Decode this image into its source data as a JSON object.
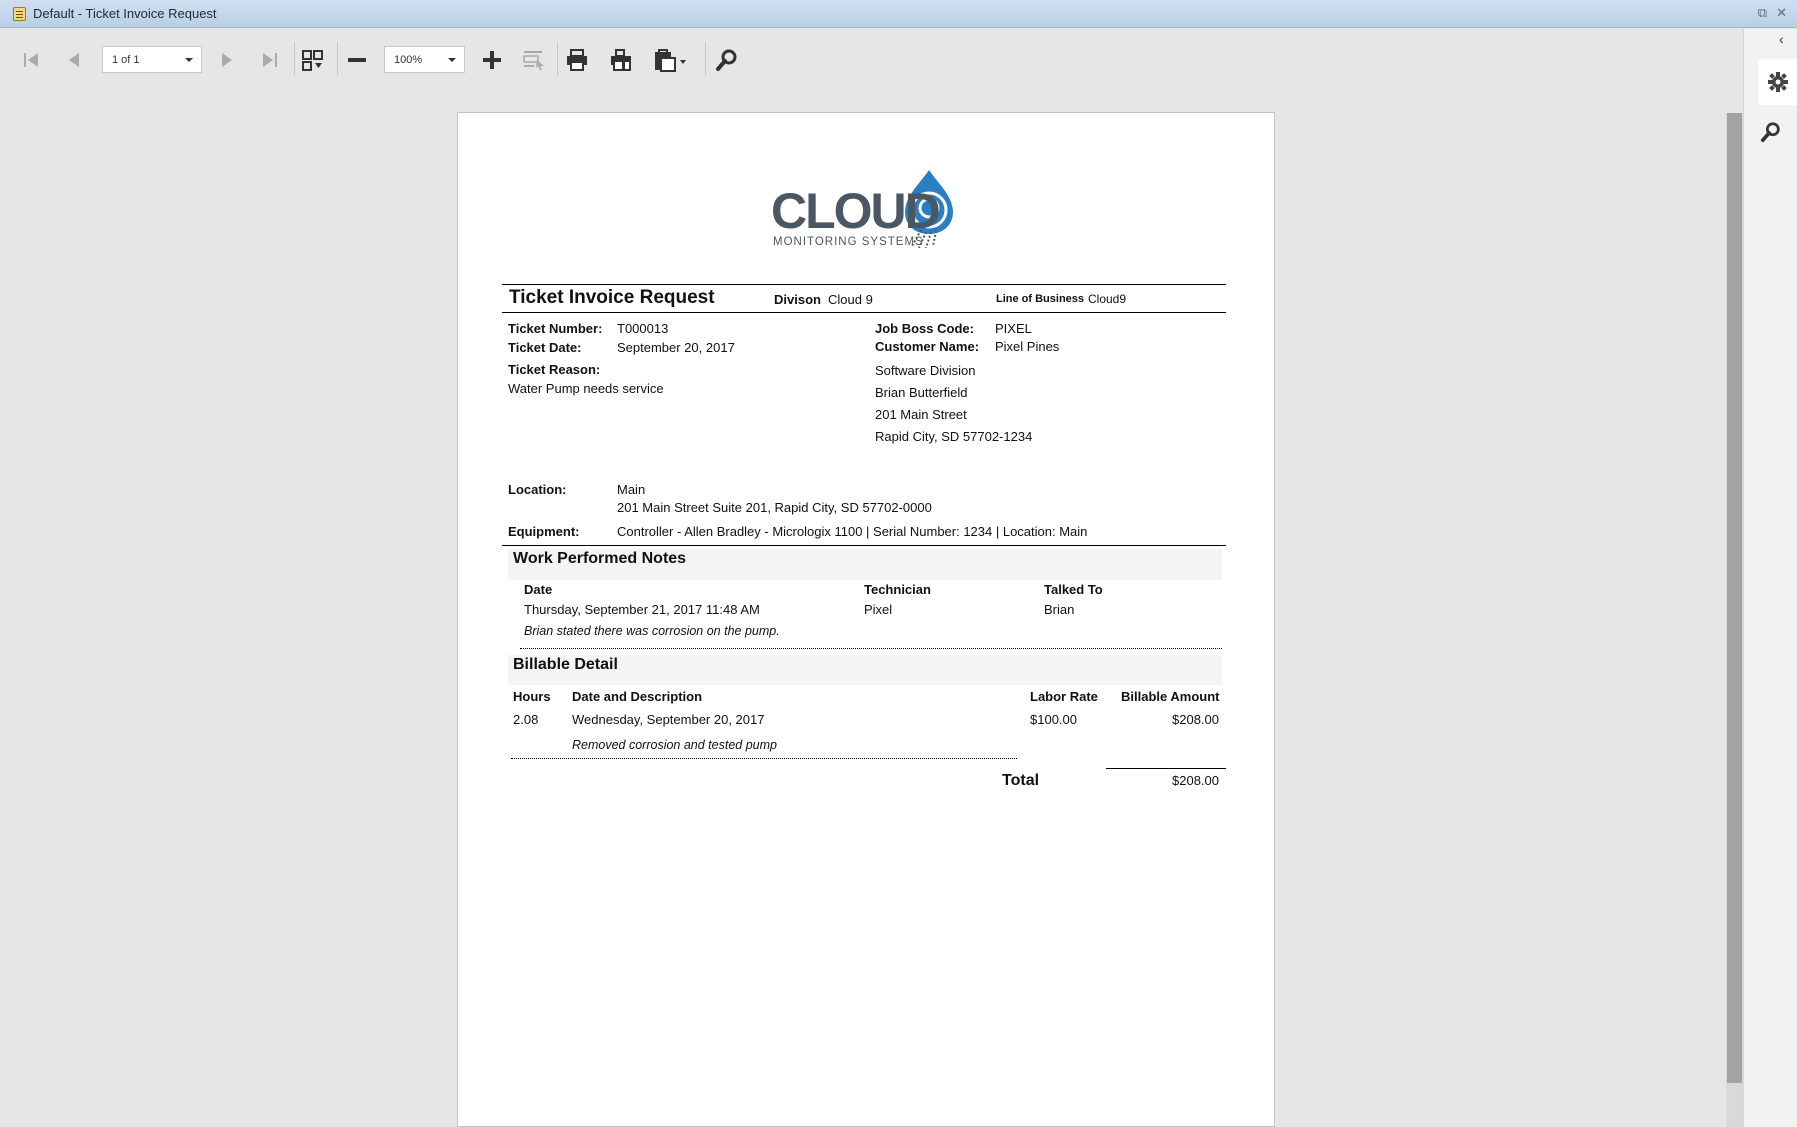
{
  "window": {
    "title": "Default - Ticket Invoice Request",
    "restore_glyph": "⧉",
    "close_glyph": "✕"
  },
  "toolbar": {
    "page_indicator": "1 of 1",
    "zoom_level": "100%"
  },
  "report": {
    "logo": {
      "brand": "CLOUD",
      "brand_digit": "9",
      "tagline": "MONITORING SYSTEMS"
    },
    "header": {
      "title": "Ticket Invoice Request",
      "division_label": "Divison",
      "division_value": "Cloud 9",
      "lob_label": "Line of Business",
      "lob_value": "Cloud9"
    },
    "ticket": {
      "number_label": "Ticket Number:",
      "number_value": "T000013",
      "date_label": "Ticket Date:",
      "date_value": "September 20, 2017",
      "reason_label": "Ticket Reason:",
      "reason_value": "Water Pump needs service"
    },
    "customer": {
      "jobboss_label": "Job Boss Code:",
      "jobboss_value": "PIXEL",
      "name_label": "Customer Name:",
      "name_value": "Pixel Pines",
      "address_lines": [
        "Software Division",
        "Brian Butterfield",
        "201 Main Street",
        "Rapid City, SD 57702-1234"
      ]
    },
    "location": {
      "label": "Location:",
      "name": "Main",
      "address": "201 Main Street Suite 201, Rapid City, SD 57702-0000"
    },
    "equipment": {
      "label": "Equipment:",
      "value": "Controller - Allen Bradley - Micrologix 1100 | Serial Number: 1234 | Location: Main"
    },
    "work_notes": {
      "heading": "Work Performed Notes",
      "columns": [
        "Date",
        "Technician",
        "Talked To"
      ],
      "rows": [
        {
          "date": "Thursday, September 21, 2017 11:48 AM",
          "technician": "Pixel",
          "talked_to": "Brian",
          "note": "Brian stated there was corrosion on the pump."
        }
      ]
    },
    "billable": {
      "heading": "Billable Detail",
      "columns": [
        "Hours",
        "Date and Description",
        "Labor Rate",
        "Billable Amount"
      ],
      "rows": [
        {
          "hours": "2.08",
          "date": "Wednesday, September 20, 2017",
          "description": "Removed corrosion and tested pump",
          "labor_rate": "$100.00",
          "amount": "$208.00"
        }
      ],
      "total_label": "Total",
      "total_value": "$208.00"
    }
  }
}
